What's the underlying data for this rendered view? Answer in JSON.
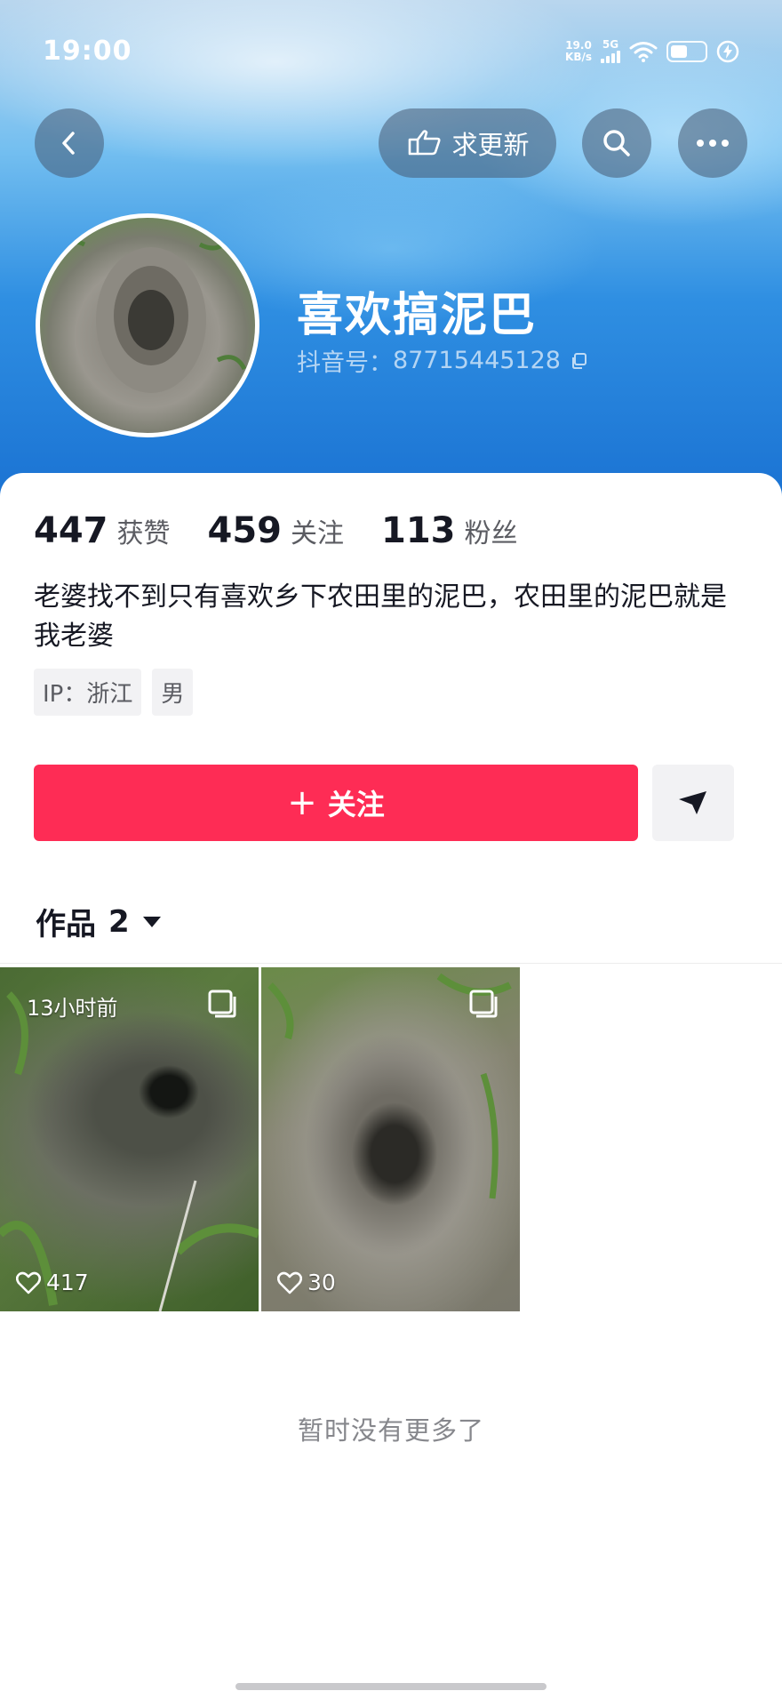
{
  "status_bar": {
    "time": "19:00",
    "net_speed_value": "19.0",
    "net_speed_unit": "KB/s",
    "network": "5G",
    "battery_icon": "battery-icon"
  },
  "header": {
    "back_icon": "back-arrow-icon",
    "request_update_label": "求更新",
    "search_icon": "search-icon",
    "more_icon": "more-icon"
  },
  "profile": {
    "name": "喜欢搞泥巴",
    "douyin_id_label": "抖音号：",
    "douyin_id": "87715445128",
    "stats": [
      {
        "value": "447",
        "label": "获赞"
      },
      {
        "value": "459",
        "label": "关注"
      },
      {
        "value": "113",
        "label": "粉丝"
      }
    ],
    "bio": "老婆找不到只有喜欢乡下农田里的泥巴，农田里的泥巴就是我老婆",
    "tags": [
      "IP：浙江",
      "男"
    ],
    "follow_label": "关注"
  },
  "works": {
    "tab_label": "作品",
    "count": "2",
    "items": [
      {
        "time": "13小时前",
        "likes": "417"
      },
      {
        "time": "",
        "likes": "30"
      }
    ],
    "no_more_text": "暂时没有更多了"
  },
  "colors": {
    "accent": "#fe2c55",
    "header_blue": "#2f8fe2"
  }
}
